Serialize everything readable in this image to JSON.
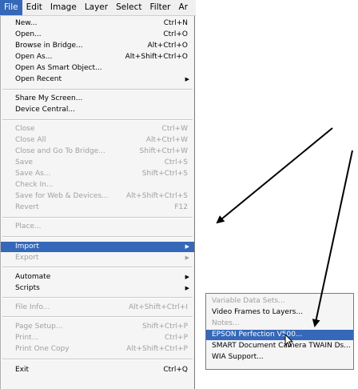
{
  "menubar": {
    "items": [
      "File",
      "Edit",
      "Image",
      "Layer",
      "Select",
      "Filter",
      "Ar"
    ],
    "active_index": 0
  },
  "file_menu": {
    "items": [
      {
        "label": "New...",
        "shortcut": "Ctrl+N"
      },
      {
        "label": "Open...",
        "shortcut": "Ctrl+O"
      },
      {
        "label": "Browse in Bridge...",
        "shortcut": "Alt+Ctrl+O"
      },
      {
        "label": "Open As...",
        "shortcut": "Alt+Shift+Ctrl+O"
      },
      {
        "label": "Open As Smart Object...",
        "shortcut": ""
      },
      {
        "label": "Open Recent",
        "shortcut": ""
      },
      {
        "label": "Share My Screen...",
        "shortcut": ""
      },
      {
        "label": "Device Central...",
        "shortcut": ""
      },
      {
        "label": "Close",
        "shortcut": "Ctrl+W"
      },
      {
        "label": "Close All",
        "shortcut": "Alt+Ctrl+W"
      },
      {
        "label": "Close and Go To Bridge...",
        "shortcut": "Shift+Ctrl+W"
      },
      {
        "label": "Save",
        "shortcut": "Ctrl+S"
      },
      {
        "label": "Save As...",
        "shortcut": "Shift+Ctrl+S"
      },
      {
        "label": "Check In...",
        "shortcut": ""
      },
      {
        "label": "Save for Web & Devices...",
        "shortcut": "Alt+Shift+Ctrl+S"
      },
      {
        "label": "Revert",
        "shortcut": "F12"
      },
      {
        "label": "Place...",
        "shortcut": ""
      },
      {
        "label": "Import",
        "shortcut": ""
      },
      {
        "label": "Export",
        "shortcut": ""
      },
      {
        "label": "Automate",
        "shortcut": ""
      },
      {
        "label": "Scripts",
        "shortcut": ""
      },
      {
        "label": "File Info...",
        "shortcut": "Alt+Shift+Ctrl+I"
      },
      {
        "label": "Page Setup...",
        "shortcut": "Shift+Ctrl+P"
      },
      {
        "label": "Print...",
        "shortcut": "Ctrl+P"
      },
      {
        "label": "Print One Copy",
        "shortcut": "Alt+Shift+Ctrl+P"
      },
      {
        "label": "Exit",
        "shortcut": "Ctrl+Q"
      }
    ]
  },
  "import_submenu": {
    "items": [
      {
        "label": "Variable Data Sets..."
      },
      {
        "label": "Video Frames to Layers..."
      },
      {
        "label": "Notes..."
      },
      {
        "label": "EPSON Perfection V500..."
      },
      {
        "label": "SMART Document Camera TWAIN Ds..."
      },
      {
        "label": "WIA Support..."
      }
    ]
  },
  "colors": {
    "highlight": "#3568b8",
    "disabled_text": "#a0a0a0",
    "menu_bg": "#f5f5f5",
    "arrow": "#000000"
  },
  "icons": {
    "submenu_arrow": "chevron-right-icon",
    "cursor": "mouse-pointer-icon"
  }
}
